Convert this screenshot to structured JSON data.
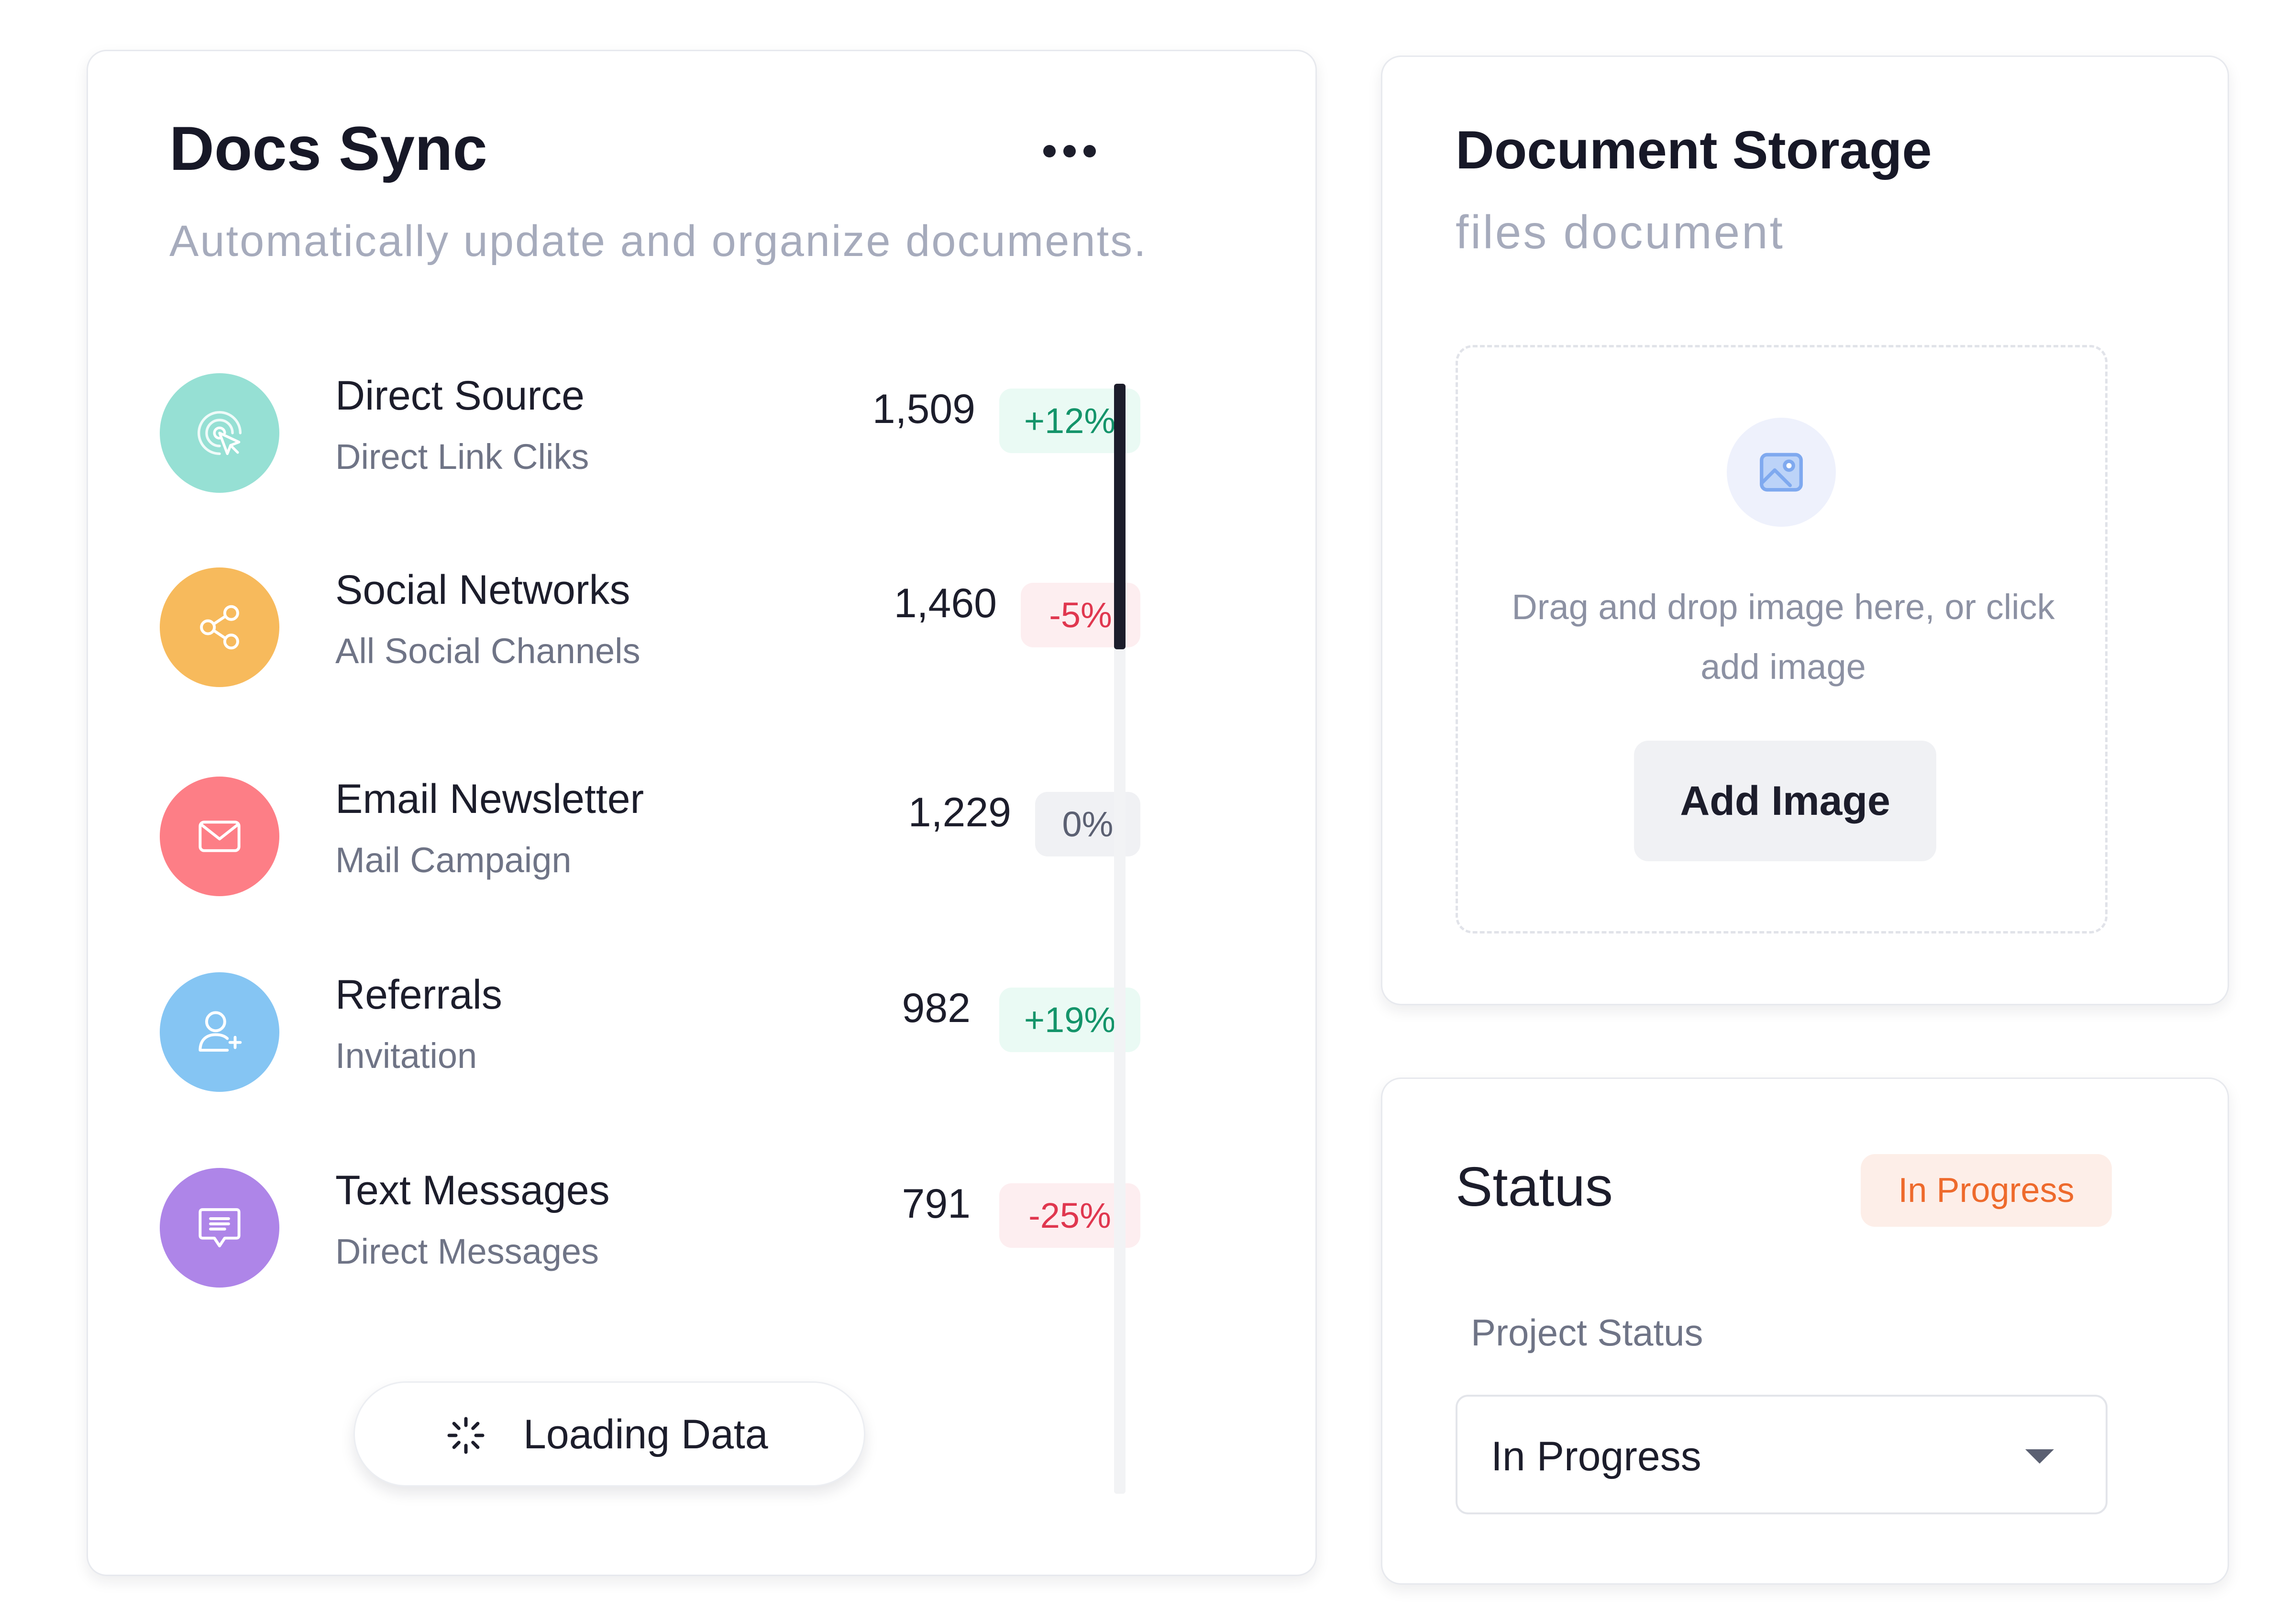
{
  "docs_sync": {
    "title": "Docs Sync",
    "subtitle": "Automatically update and organize documents.",
    "more_icon": "more-horizontal-icon",
    "sources": [
      {
        "name": "Direct Source",
        "desc": "Direct Link Cliks",
        "value": "1,509",
        "change": "+12%",
        "trend": "positive",
        "icon": "cursor-click-icon",
        "color": "#96e0d4"
      },
      {
        "name": "Social Networks",
        "desc": "All Social Channels",
        "value": "1,460",
        "change": "-5%",
        "trend": "negative",
        "icon": "share-icon",
        "color": "#f7ba5c"
      },
      {
        "name": "Email Newsletter",
        "desc": "Mail Campaign",
        "value": "1,229",
        "change": "0%",
        "trend": "neutral",
        "icon": "envelope-icon",
        "color": "#fd7e86"
      },
      {
        "name": "Referrals",
        "desc": "Invitation",
        "value": "982",
        "change": "+19%",
        "trend": "positive",
        "icon": "user-plus-icon",
        "color": "#85c5f3"
      },
      {
        "name": "Text Messages",
        "desc": "Direct Messages",
        "value": "791",
        "change": "-25%",
        "trend": "negative",
        "icon": "chat-message-icon",
        "color": "#ae85e8"
      }
    ],
    "loading_label": "Loading Data",
    "loading_icon": "spinner-icon"
  },
  "storage": {
    "title": "Document Storage",
    "subtitle": "files document",
    "image_icon": "image-icon",
    "dropzone_text": "Drag and drop image here, or click add image",
    "add_button": "Add Image"
  },
  "status": {
    "title": "Status",
    "badge": "In Progress",
    "field_label": "Project Status",
    "selected": "In Progress"
  },
  "colors": {
    "positive": "#14946a",
    "negative": "#e0374f",
    "neutral": "#5b6072",
    "status_badge": "#ee6a2c",
    "image_icon": "#7fa9ef"
  }
}
